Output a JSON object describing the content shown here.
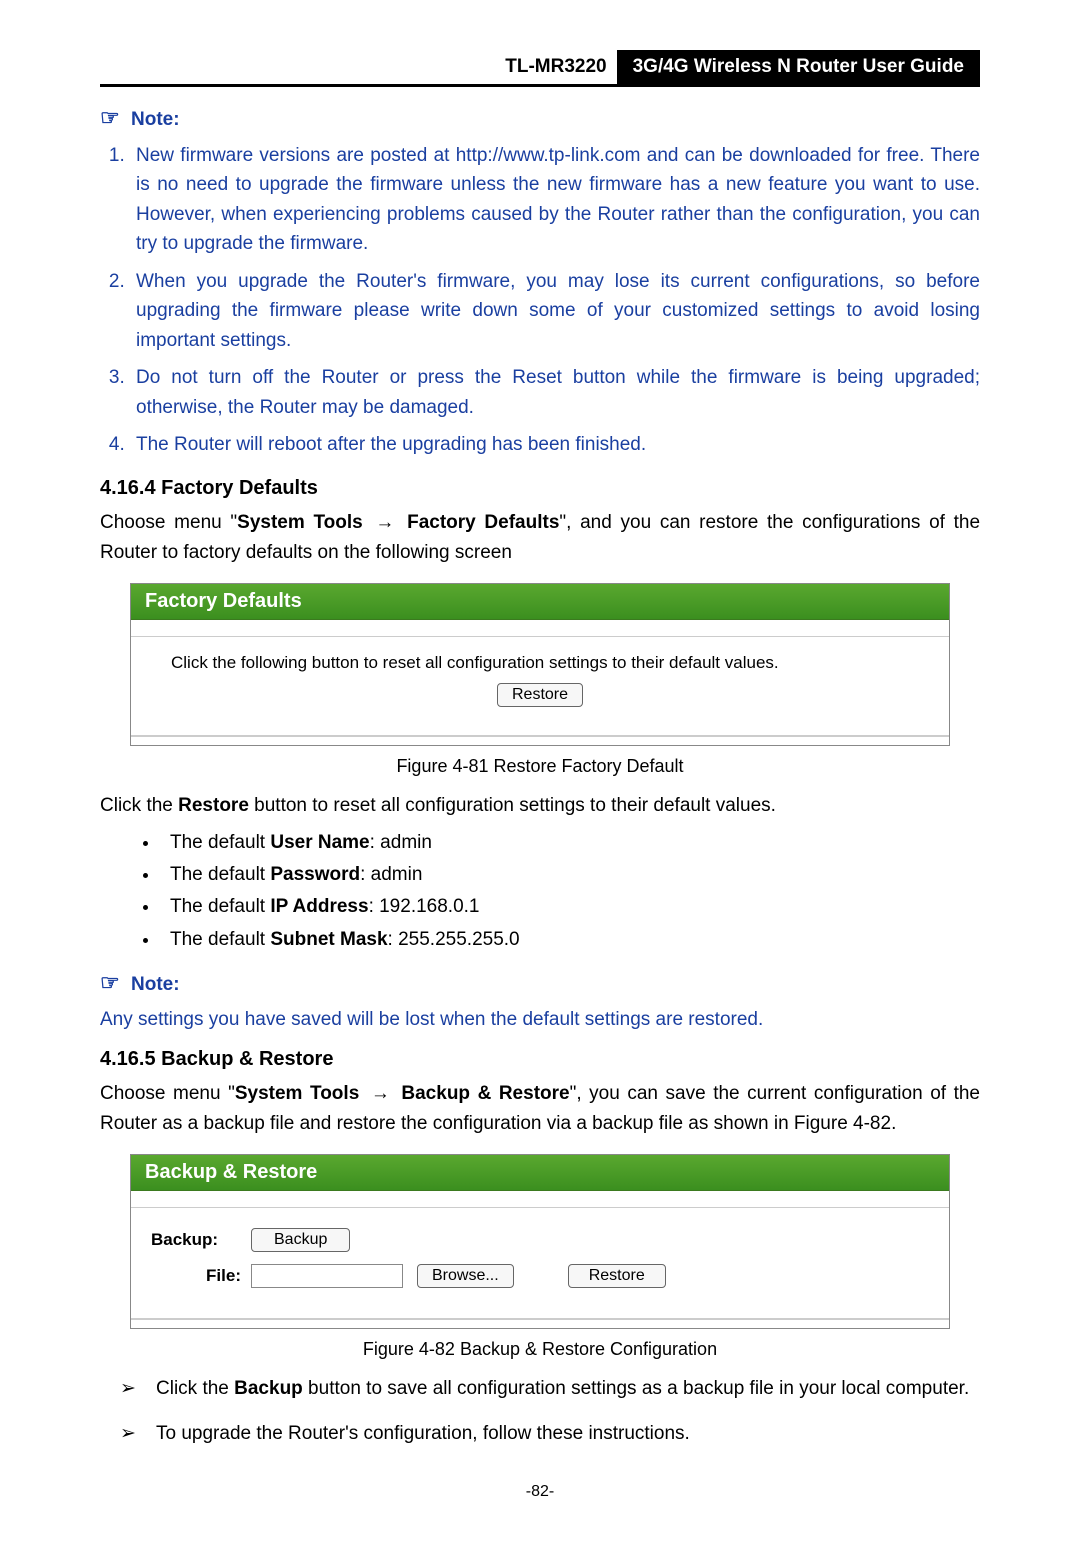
{
  "header": {
    "model": "TL-MR3220",
    "guide_title": "3G/4G Wireless N Router User Guide"
  },
  "note1": {
    "label": "Note:",
    "items": [
      "New firmware versions are posted at http://www.tp-link.com and can be downloaded for free. There is no need to upgrade the firmware unless the new firmware has a new feature you want to use. However, when experiencing problems caused by the Router rather than the configuration, you can try to upgrade the firmware.",
      "When you upgrade the Router's firmware, you may lose its current configurations, so before upgrading the firmware please write down some of your customized settings to avoid losing important settings.",
      "Do not turn off the Router or press the Reset button while the firmware is being upgraded; otherwise, the Router may be damaged.",
      "The Router will reboot after the upgrading has been finished."
    ]
  },
  "section1": {
    "heading": "4.16.4   Factory Defaults",
    "intro_prefix": "Choose menu \"",
    "intro_bold1": "System Tools",
    "intro_arrow": "→",
    "intro_bold2": "Factory Defaults",
    "intro_suffix": "\", and you can restore the configurations of the Router to factory defaults on the following screen"
  },
  "fig81": {
    "title": "Factory Defaults",
    "text": "Click the following button to reset all configuration settings to their default values.",
    "btn": "Restore",
    "caption": "Figure 4-81 Restore Factory Default"
  },
  "restore_para_prefix": "Click the ",
  "restore_bold": "Restore",
  "restore_para_suffix": " button to reset all configuration settings to their default values.",
  "defaults": [
    {
      "pre": "The default ",
      "bold": "User Name",
      "post": ": admin"
    },
    {
      "pre": "The default ",
      "bold": "Password",
      "post": ": admin"
    },
    {
      "pre": "The default ",
      "bold": "IP Address",
      "post": ": 192.168.0.1"
    },
    {
      "pre": "The default ",
      "bold": "Subnet Mask",
      "post": ": 255.255.255.0"
    }
  ],
  "note2": {
    "label": "Note:",
    "body": "Any settings you have saved will be lost when the default settings are restored."
  },
  "section2": {
    "heading": "4.16.5   Backup & Restore",
    "intro_prefix": "Choose menu \"",
    "intro_bold1": "System Tools",
    "intro_arrow": "→",
    "intro_bold2": "Backup & Restore",
    "intro_suffix": "\", you can save the current configuration of the Router as a backup file and restore the configuration via a backup file as shown in Figure 4-82."
  },
  "fig82": {
    "title": "Backup & Restore",
    "backup_label": "Backup:",
    "backup_btn": "Backup",
    "file_label": "File:",
    "browse_btn": "Browse...",
    "restore_btn": "Restore",
    "caption": "Figure 4-82    Backup & Restore Configuration"
  },
  "arrow_items": [
    {
      "pre": "Click the ",
      "bold": "Backup",
      "post": " button to save all configuration settings as a backup file in your local computer."
    },
    {
      "pre": "",
      "bold": "",
      "post": "To upgrade the Router's configuration, follow these instructions."
    }
  ],
  "page_number": "-82-"
}
